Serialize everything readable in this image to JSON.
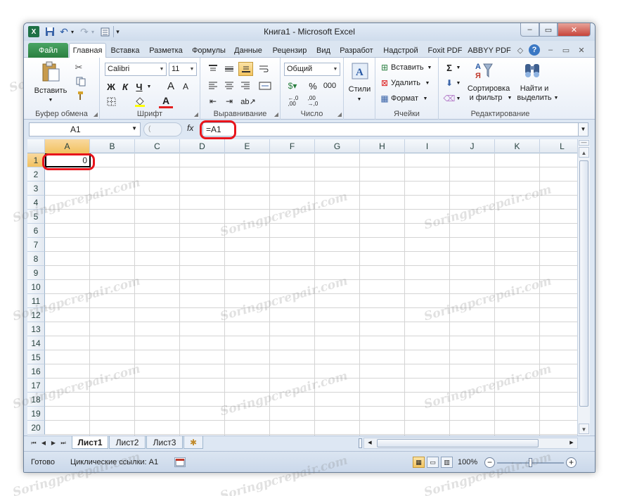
{
  "window": {
    "title": "Книга1  -  Microsoft Excel",
    "controls": {
      "minimize": "–",
      "maximize": "▭",
      "close": "✕"
    }
  },
  "qat": {
    "app_icon": "X",
    "undo": "↶",
    "redo": "↷",
    "customize": "▾"
  },
  "tabs": [
    "Файл",
    "Главная",
    "Вставка",
    "Разметка",
    "Формулы",
    "Данные",
    "Рецензир",
    "Вид",
    "Разработ",
    "Надстрой",
    "Foxit PDF",
    "ABBYY PDF"
  ],
  "tab_icons": {
    "minimize_ribbon": "◇",
    "help": "?",
    "doc_min": "–",
    "doc_restore": "▭",
    "doc_close": "✕"
  },
  "ribbon": {
    "clipboard": {
      "label": "Буфер обмена",
      "paste": "Вставить"
    },
    "font": {
      "label": "Шрифт",
      "name": "Calibri",
      "size": "11",
      "bold": "Ж",
      "italic": "К",
      "underline": "Ч",
      "grow": "A",
      "shrink": "A"
    },
    "alignment": {
      "label": "Выравнивание"
    },
    "number": {
      "label": "Число",
      "format": "Общий",
      "percent": "%",
      "thousands": "000"
    },
    "styles": {
      "label": "Стили"
    },
    "cells": {
      "label": "Ячейки",
      "insert": "Вставить",
      "delete": "Удалить",
      "format": "Формат"
    },
    "editing": {
      "label": "Редактирование",
      "sort_line1": "Сортировка",
      "sort_line2": "и фильтр",
      "find_line1": "Найти и",
      "find_line2": "выделить"
    }
  },
  "formula_bar": {
    "name_box": "A1",
    "fx": "fx",
    "formula": "=A1"
  },
  "grid": {
    "columns": [
      "A",
      "B",
      "C",
      "D",
      "E",
      "F",
      "G",
      "H",
      "I",
      "J",
      "K",
      "L"
    ],
    "selected_column": "A",
    "rows": [
      "1",
      "2",
      "3",
      "4",
      "5",
      "6",
      "7",
      "8",
      "9",
      "10",
      "11",
      "12",
      "13",
      "14",
      "15",
      "16",
      "17",
      "18",
      "19",
      "20"
    ],
    "selected_row": "1",
    "cell_a1_value": "0"
  },
  "sheets": [
    "Лист1",
    "Лист2",
    "Лист3"
  ],
  "active_sheet": "Лист1",
  "status": {
    "ready": "Готово",
    "circular": "Циклические ссылки: A1",
    "zoom": "100%"
  },
  "watermark": "Soringpcrepair.com",
  "colors": {
    "accent_red": "#e8141b",
    "file_tab": "#2a7f40",
    "selection_header": "#f1c15f"
  }
}
